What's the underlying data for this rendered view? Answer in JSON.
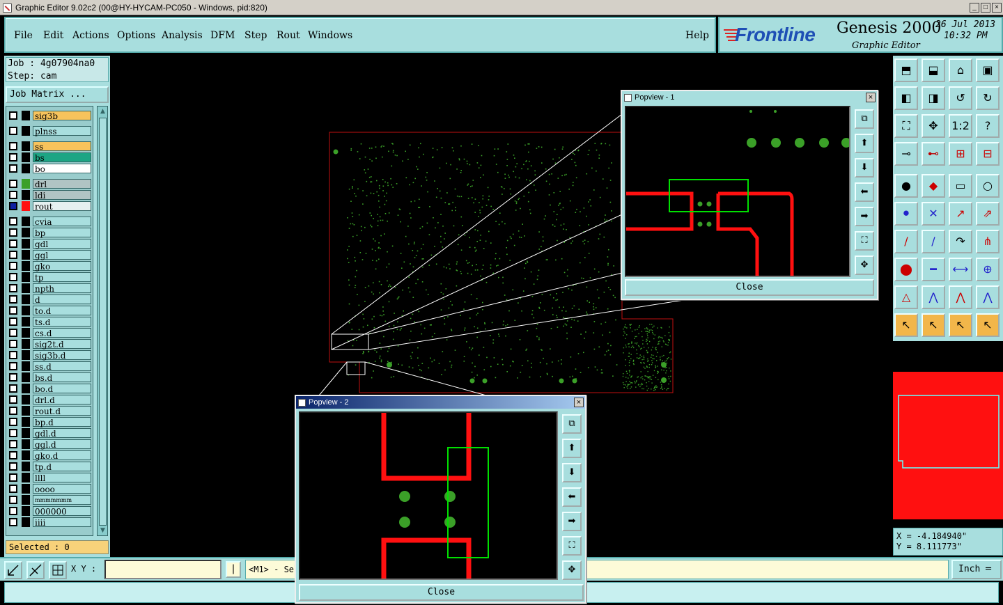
{
  "window": {
    "title": "Graphic Editor 9.02c2 (00@HY-HYCAM-PC050 - Windows, pid:820)",
    "minimize": "_",
    "maximize": "□",
    "close": "×"
  },
  "menu": {
    "file": "File",
    "edit": "Edit",
    "actions": "Actions",
    "options": "Options",
    "analysis": "Analysis",
    "dfm": "DFM",
    "step": "Step",
    "rout": "Rout",
    "windows": "Windows",
    "help": "Help"
  },
  "logo": {
    "brand": "Frontline",
    "product": "Genesis 2000",
    "subtitle": "Graphic Editor",
    "date": "26 Jul 2013",
    "time": "10:32 PM"
  },
  "job": {
    "job_line": "Job : 4g07904na0",
    "step_line": "Step: cam",
    "matrix_button": "Job Matrix ..."
  },
  "layers": [
    {
      "name": "sig3b",
      "color": "#f7c35c",
      "swatch": "#000"
    },
    {
      "name": "plnss",
      "color": "#a8dede",
      "swatch": "#000"
    },
    {
      "name": "ss",
      "color": "#f7c35c",
      "swatch": "#000"
    },
    {
      "name": "bs",
      "color": "#1da584",
      "swatch": "#000"
    },
    {
      "name": "bo",
      "color": "#ffffff",
      "swatch": "#000"
    },
    {
      "name": "drl",
      "color": "#b0c4c4",
      "swatch": "#3ba028"
    },
    {
      "name": "ldi",
      "color": "#b0c4c4",
      "swatch": "#000"
    },
    {
      "name": "rout",
      "color": "#e6f0f0",
      "swatch": "#ff1010"
    },
    {
      "name": "cvia",
      "color": "#a8dede",
      "swatch": "#000"
    },
    {
      "name": "bp",
      "color": "#a8dede",
      "swatch": "#000"
    },
    {
      "name": "gdl",
      "color": "#a8dede",
      "swatch": "#000"
    },
    {
      "name": "ggl",
      "color": "#a8dede",
      "swatch": "#000"
    },
    {
      "name": "gko",
      "color": "#a8dede",
      "swatch": "#000"
    },
    {
      "name": "tp",
      "color": "#a8dede",
      "swatch": "#000"
    },
    {
      "name": "npth",
      "color": "#a8dede",
      "swatch": "#000"
    },
    {
      "name": "d",
      "color": "#a8dede",
      "swatch": "#000"
    },
    {
      "name": "to.d",
      "color": "#a8dede",
      "swatch": "#000"
    },
    {
      "name": "ts.d",
      "color": "#a8dede",
      "swatch": "#000"
    },
    {
      "name": "cs.d",
      "color": "#a8dede",
      "swatch": "#000"
    },
    {
      "name": "sig2t.d",
      "color": "#a8dede",
      "swatch": "#000"
    },
    {
      "name": "sig3b.d",
      "color": "#a8dede",
      "swatch": "#000"
    },
    {
      "name": "ss.d",
      "color": "#a8dede",
      "swatch": "#000"
    },
    {
      "name": "bs.d",
      "color": "#a8dede",
      "swatch": "#000"
    },
    {
      "name": "bo.d",
      "color": "#a8dede",
      "swatch": "#000"
    },
    {
      "name": "drl.d",
      "color": "#a8dede",
      "swatch": "#000"
    },
    {
      "name": "rout.d",
      "color": "#a8dede",
      "swatch": "#000"
    },
    {
      "name": "bp.d",
      "color": "#a8dede",
      "swatch": "#000"
    },
    {
      "name": "gdl.d",
      "color": "#a8dede",
      "swatch": "#000"
    },
    {
      "name": "ggl.d",
      "color": "#a8dede",
      "swatch": "#000"
    },
    {
      "name": "gko.d",
      "color": "#a8dede",
      "swatch": "#000"
    },
    {
      "name": "tp.d",
      "color": "#a8dede",
      "swatch": "#000"
    },
    {
      "name": "llll",
      "color": "#a8dede",
      "swatch": "#000"
    },
    {
      "name": "oooo",
      "color": "#a8dede",
      "swatch": "#000"
    },
    {
      "name": "mmmmmmm",
      "color": "#a8dede",
      "swatch": "#000"
    },
    {
      "name": "000000",
      "color": "#a8dede",
      "swatch": "#000"
    },
    {
      "name": "iiii",
      "color": "#a8dede",
      "swatch": "#000"
    }
  ],
  "selected": "Selected : 0",
  "bottom": {
    "xy_label": "X Y :",
    "xy_value": "",
    "pipe": "|",
    "message": "<M1> - Sel",
    "units": "Inch ═"
  },
  "coords": {
    "x": "X = -4.184940\"",
    "y": "Y = 8.111773\""
  },
  "popview1": {
    "title": "Popview - 1",
    "close": "Close"
  },
  "popview2": {
    "title": "Popview - 2",
    "close": "Close"
  },
  "colors": {
    "panel": "#a8dede",
    "trace": "#ff1010",
    "pad": "#3ba028",
    "highlight": "#00e000",
    "board_outline": "#c01010"
  }
}
